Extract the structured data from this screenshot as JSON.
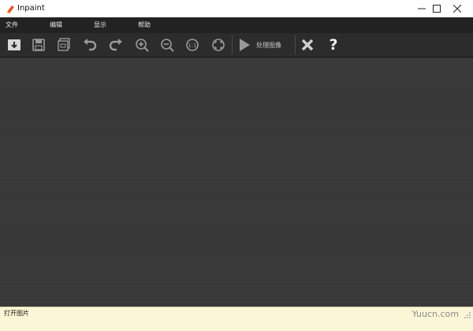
{
  "window": {
    "title": "Inpaint"
  },
  "menu": {
    "items": [
      "文件",
      "编辑",
      "显示",
      "帮助"
    ]
  },
  "toolbar": {
    "buttons": [
      "open-icon",
      "save-icon",
      "save-as-icon",
      "undo-icon",
      "redo-icon",
      "zoom-in-icon",
      "zoom-out-icon",
      "actual-size-icon",
      "fit-icon"
    ],
    "process_label": "处理图像",
    "close_icon": "close-icon",
    "help_label": "?"
  },
  "status": {
    "text": "打开图片"
  },
  "watermark": {
    "text": "Yuucn.com"
  },
  "colors": {
    "menubar": "#222222",
    "toolbar": "#2c2c2c",
    "workspace": "#3a3a3a",
    "status": "#fbf6d6"
  }
}
